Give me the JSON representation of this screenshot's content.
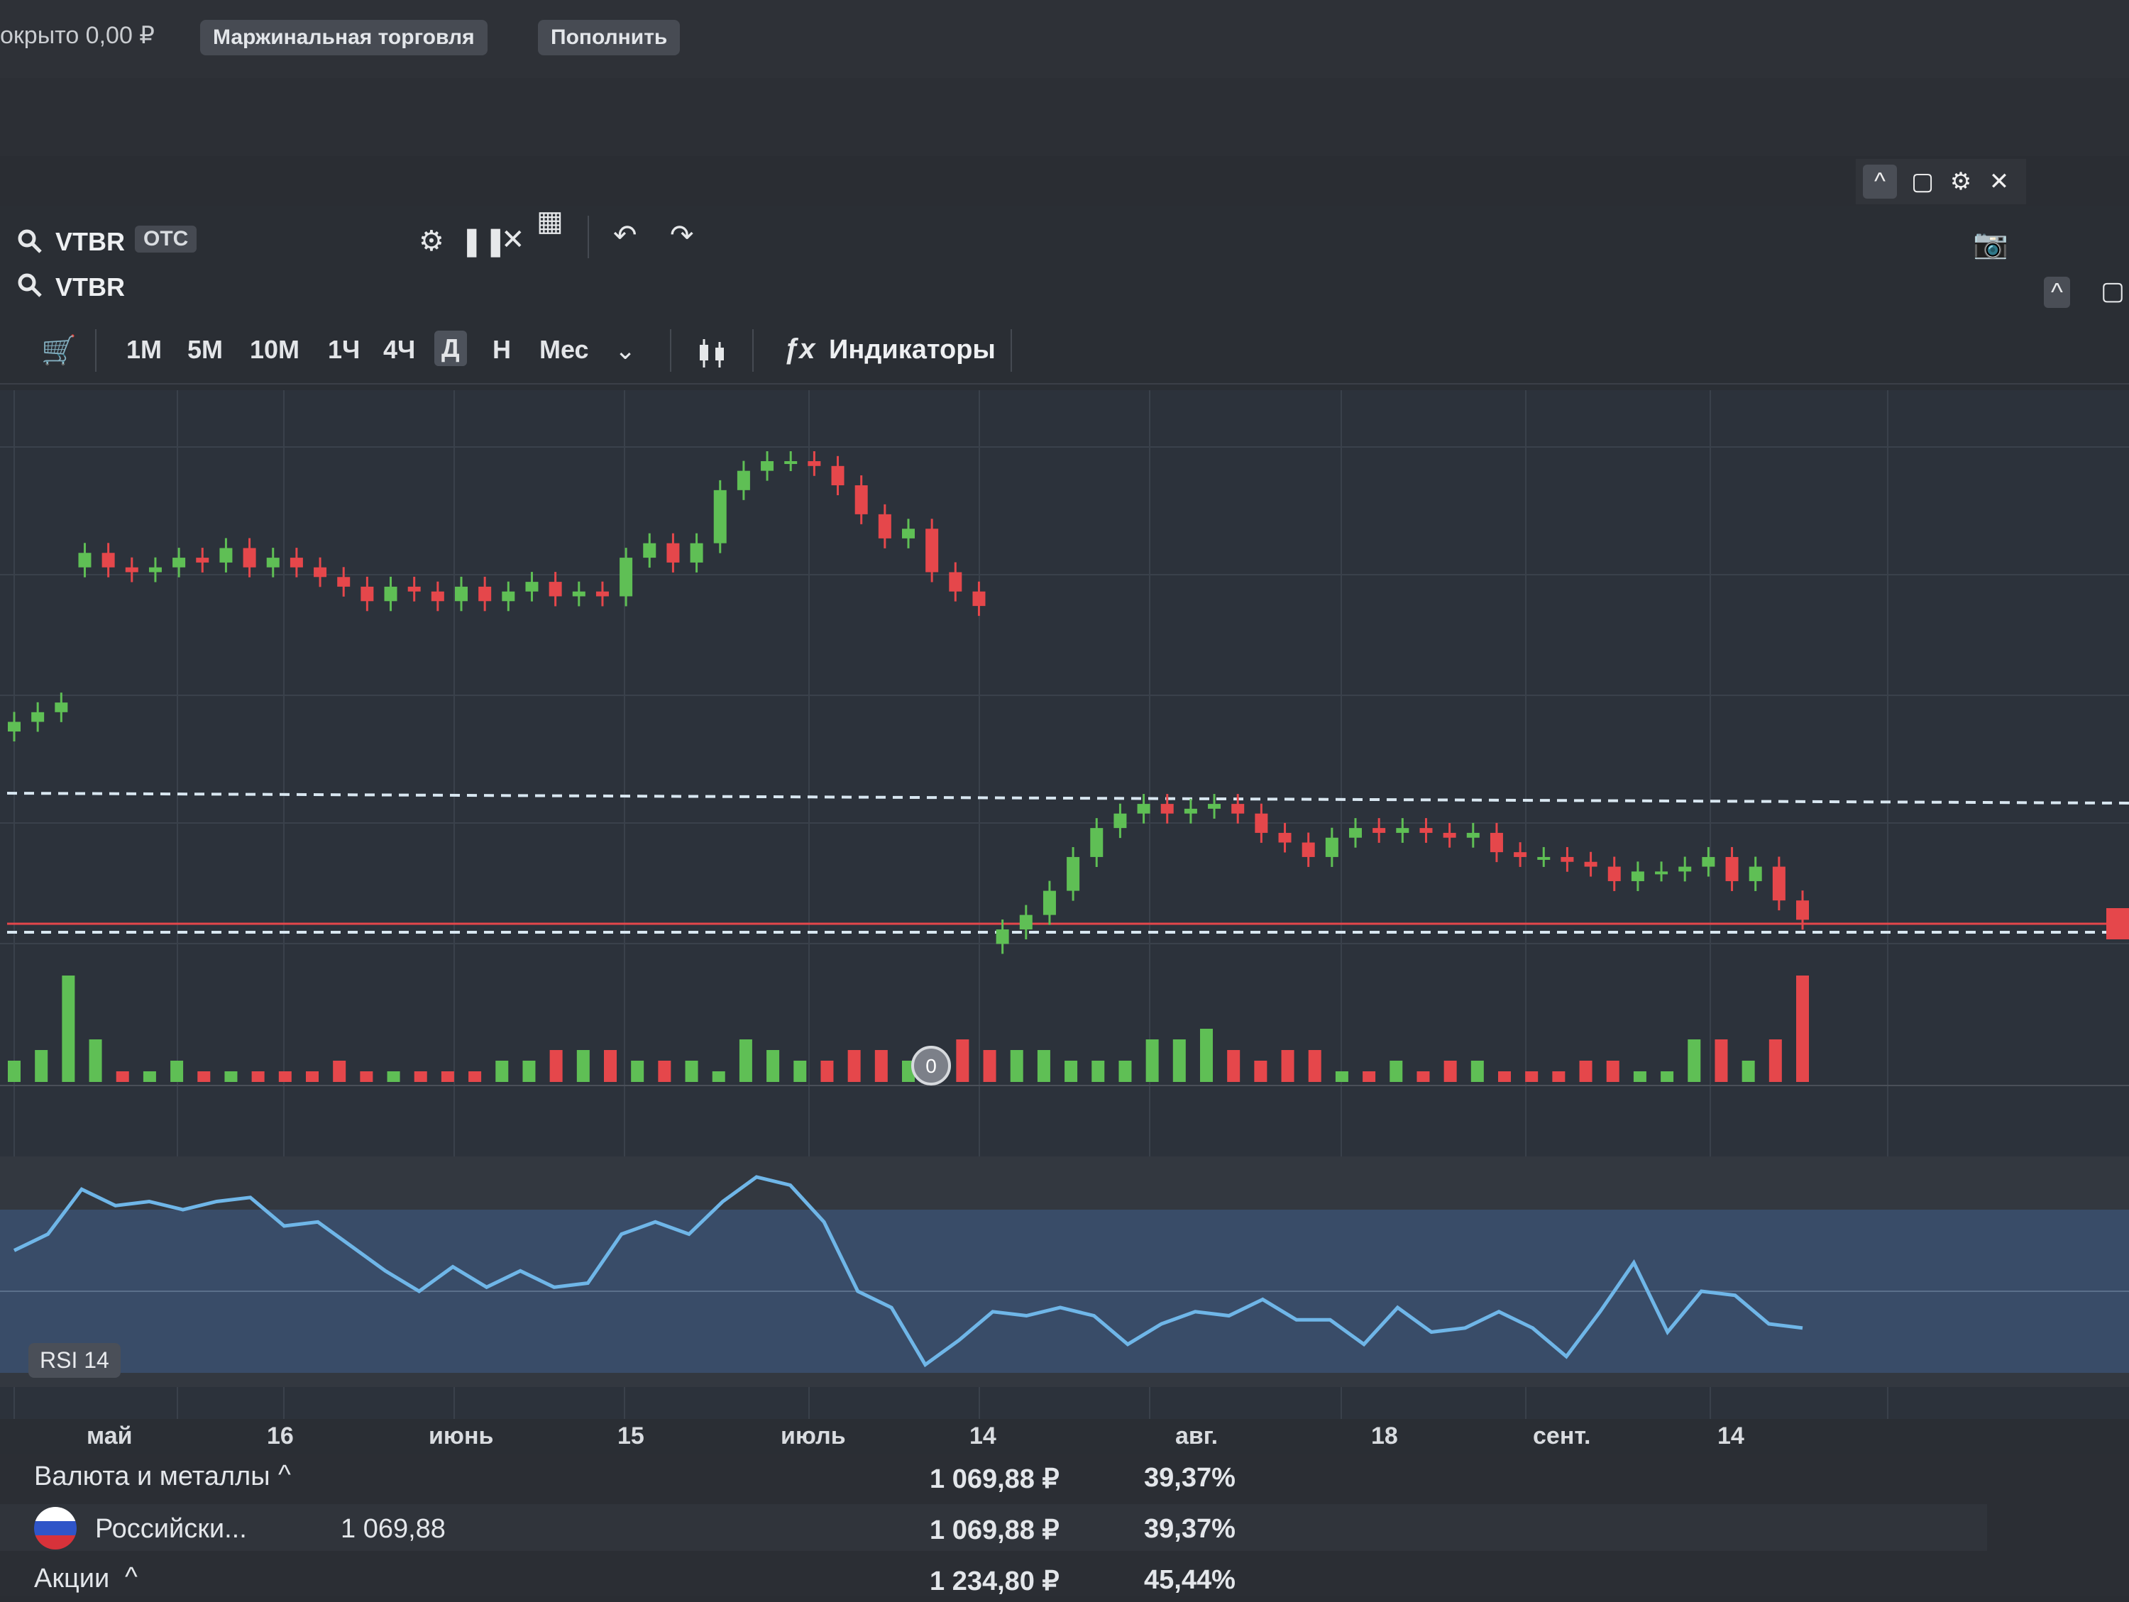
{
  "topbar": {
    "uncovered": "окрыто 0,00 ₽",
    "margin_button": "Маржинальная торговля",
    "deposit_button": "Пополнить"
  },
  "window_controls": {
    "collapse": "^",
    "restore": "▢",
    "settings": "⚙",
    "close": "✕"
  },
  "panel": {
    "symbol_primary": "VTBR",
    "badge": "OTC",
    "symbol_secondary": "VTBR",
    "timeframes": [
      "1М",
      "5М",
      "10М",
      "1Ч",
      "4Ч",
      "Д",
      "Н",
      "Мес"
    ],
    "active_timeframe": "Д",
    "indicators_label": "Индикаторы",
    "rsi_label": "RSI 14",
    "volume_marker": "0"
  },
  "x_axis": [
    "май",
    "16",
    "июнь",
    "15",
    "июль",
    "14",
    "авг.",
    "18",
    "сент.",
    "14"
  ],
  "colors": {
    "up": "#5fbf55",
    "down": "#e5474b",
    "rsi_line": "#6fb6e8",
    "rsi_band": "#3d5370"
  },
  "bottom_table": {
    "rows": [
      {
        "label": "Валюта и металлы",
        "qty": "",
        "value": "1 069,88 ₽",
        "percent": "39,37%"
      },
      {
        "label": "Российски...",
        "qty": "1 069,88",
        "value": "1 069,88 ₽",
        "percent": "39,37%"
      },
      {
        "label": "Акции",
        "qty": "",
        "value": "1 234,80 ₽",
        "percent": "45,44%"
      }
    ]
  },
  "chart_data": {
    "type": "candlestick",
    "x_labels": [
      "май",
      "16",
      "июнь",
      "15",
      "июль",
      "14",
      "авг.",
      "18",
      "сент.",
      "14"
    ],
    "close_trend": [
      0.93,
      0.95,
      0.97,
      1.28,
      1.25,
      1.24,
      1.25,
      1.27,
      1.26,
      1.29,
      1.25,
      1.27,
      1.25,
      1.23,
      1.21,
      1.18,
      1.21,
      1.2,
      1.18,
      1.21,
      1.18,
      1.2,
      1.22,
      1.19,
      1.2,
      1.19,
      1.27,
      1.3,
      1.26,
      1.3,
      1.41,
      1.45,
      1.47,
      1.47,
      1.46,
      1.42,
      1.36,
      1.31,
      1.33,
      1.24,
      1.2,
      1.17,
      0.5,
      0.53,
      0.58,
      0.65,
      0.71,
      0.74,
      0.76,
      0.74,
      0.75,
      0.76,
      0.74,
      0.7,
      0.68,
      0.65,
      0.69,
      0.71,
      0.7,
      0.71,
      0.7,
      0.69,
      0.7,
      0.66,
      0.65,
      0.65,
      0.64,
      0.63,
      0.6,
      0.62,
      0.62,
      0.63,
      0.65,
      0.6,
      0.63,
      0.56,
      0.52
    ],
    "rsi_trend": [
      60,
      64,
      75,
      71,
      72,
      70,
      72,
      73,
      66,
      67,
      61,
      55,
      50,
      56,
      51,
      55,
      51,
      52,
      64,
      67,
      64,
      72,
      78,
      76,
      67,
      50,
      46,
      32,
      38,
      45,
      44,
      46,
      44,
      37,
      42,
      45,
      44,
      48,
      43,
      43,
      37,
      46,
      40,
      41,
      45,
      41,
      34,
      45,
      57,
      40,
      50,
      49,
      42,
      41
    ],
    "volume_trend": [
      2,
      3,
      10,
      4,
      1,
      1,
      2,
      1,
      1,
      1,
      1,
      1,
      2,
      1,
      1,
      1,
      1,
      1,
      2,
      2,
      3,
      3,
      3,
      2,
      2,
      2,
      1,
      4,
      3,
      2,
      2,
      3,
      3,
      2,
      3,
      4,
      3,
      3,
      3,
      2,
      2,
      2,
      4,
      4,
      5,
      3,
      2,
      3,
      3,
      1,
      1,
      2,
      1,
      2,
      2,
      1,
      1,
      1,
      2,
      2,
      1,
      1,
      4,
      4,
      2,
      4,
      10
    ]
  }
}
